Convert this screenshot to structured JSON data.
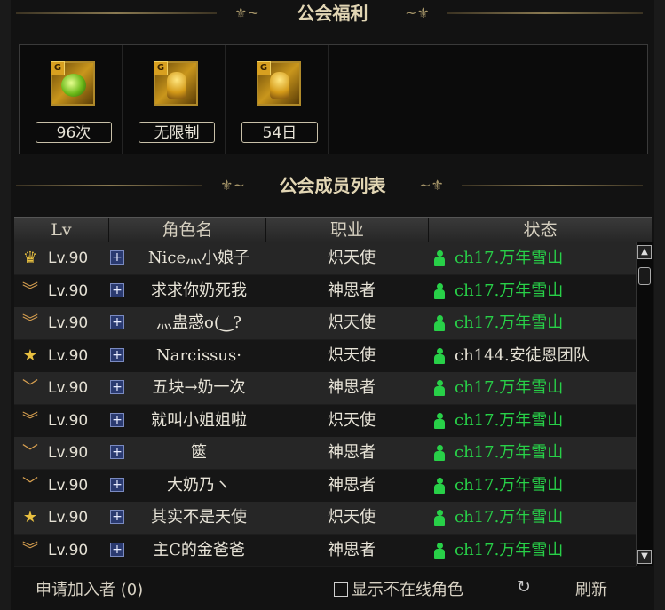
{
  "benefits_section": {
    "title": "公会福利"
  },
  "benefits": [
    {
      "icon": "green-potion-icon",
      "label": "96次"
    },
    {
      "icon": "golden-figure-icon",
      "label": "无限制"
    },
    {
      "icon": "golden-figure-icon",
      "label": "54日"
    }
  ],
  "members_section": {
    "title": "公会成员列表"
  },
  "table": {
    "headers": {
      "lv": "Lv",
      "name": "角色名",
      "job": "职业",
      "status": "状态"
    },
    "rows": [
      {
        "rank": "crown-icon",
        "lv": "Lv.90",
        "name": "Nice灬小娘子",
        "job": "炽天使",
        "status": "ch17.万年雪山",
        "online": true
      },
      {
        "rank": "double-chevron-icon",
        "lv": "Lv.90",
        "name": "求求你奶死我",
        "job": "神思者",
        "status": "ch17.万年雪山",
        "online": true
      },
      {
        "rank": "double-chevron-icon",
        "lv": "Lv.90",
        "name": "灬蛊惑o(‿?",
        "job": "炽天使",
        "status": "ch17.万年雪山",
        "online": true
      },
      {
        "rank": "star-icon",
        "lv": "Lv.90",
        "name": "Narcissus·",
        "job": "炽天使",
        "status": "ch144.安徒恩团队",
        "online": false
      },
      {
        "rank": "chevron-icon",
        "lv": "Lv.90",
        "name": "五块→奶一次",
        "job": "神思者",
        "status": "ch17.万年雪山",
        "online": true
      },
      {
        "rank": "double-chevron-icon",
        "lv": "Lv.90",
        "name": "就叫小姐姐啦",
        "job": "炽天使",
        "status": "ch17.万年雪山",
        "online": true
      },
      {
        "rank": "chevron-icon",
        "lv": "Lv.90",
        "name": "篋",
        "job": "神思者",
        "status": "ch17.万年雪山",
        "online": true
      },
      {
        "rank": "chevron-icon",
        "lv": "Lv.90",
        "name": "大奶乃ヽ",
        "job": "神思者",
        "status": "ch17.万年雪山",
        "online": true
      },
      {
        "rank": "star-icon",
        "lv": "Lv.90",
        "name": "其实不是天使",
        "job": "炽天使",
        "status": "ch17.万年雪山",
        "online": true
      },
      {
        "rank": "double-chevron-icon",
        "lv": "Lv.90",
        "name": "主C的金爸爸",
        "job": "神思者",
        "status": "ch17.万年雪山",
        "online": true
      }
    ]
  },
  "footer": {
    "applicants": "申请加入者 (0)",
    "show_offline": "显示不在线角色",
    "refresh": "刷新"
  },
  "colors": {
    "online": "#28d048",
    "header_gold": "#e2d6b4"
  }
}
